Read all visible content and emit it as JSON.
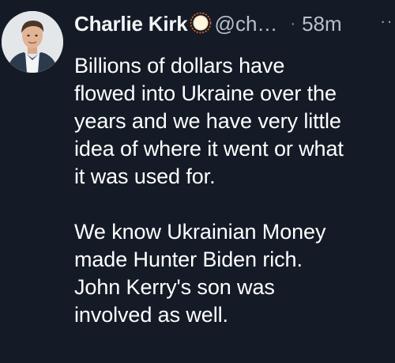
{
  "author": {
    "display_name": "Charlie Kirk",
    "handle": "@ch…",
    "separator": "·",
    "timestamp": "58m",
    "badge_icon": "sun-emoji-icon",
    "avatar_icon": "profile-photo-icon"
  },
  "menu": {
    "more_label": "···",
    "more_icon": "more-options-icon"
  },
  "tweet": {
    "paragraph_1": [
      "Billions of dollars have",
      "flowed into Ukraine over the",
      "years and we have very little",
      "idea of where it went or what",
      "it was used for."
    ],
    "paragraph_2": [
      "We know Ukrainian Money",
      "made Hunter Biden rich.",
      "John Kerry's son was",
      "involved as well."
    ]
  },
  "colors": {
    "background": "#141b27",
    "text": "#ffffff",
    "secondary_text": "#b8c0c8"
  }
}
